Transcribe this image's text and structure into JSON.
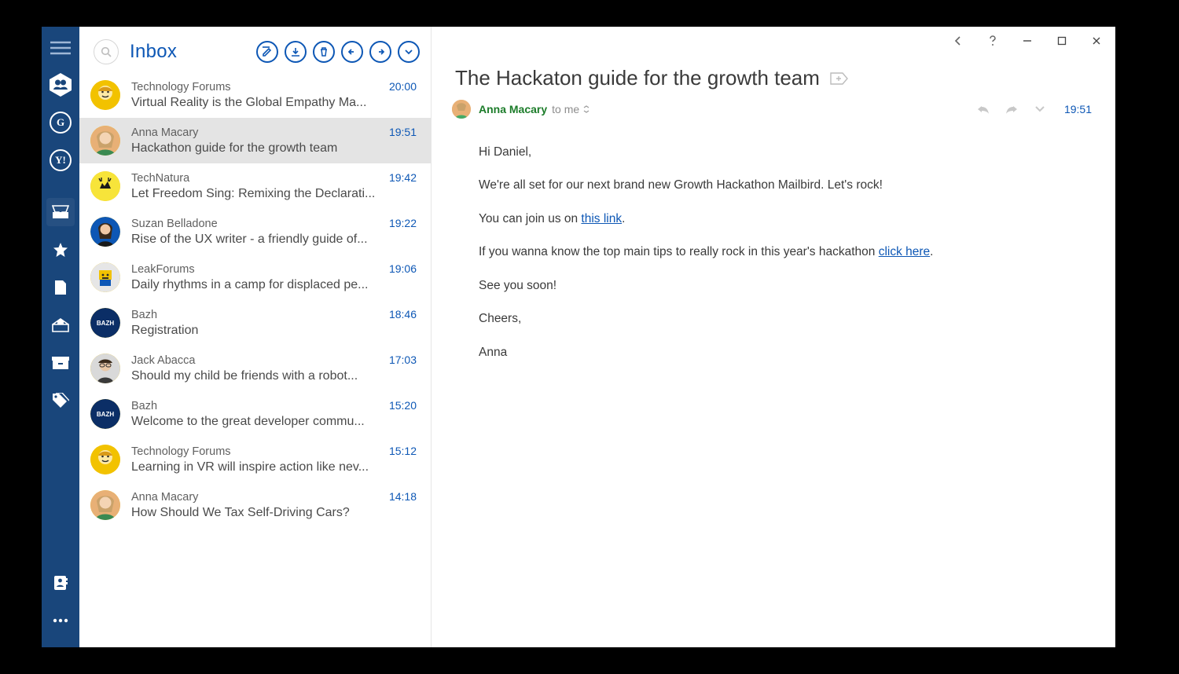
{
  "sidebar": {
    "accounts": [
      {
        "kind": "hex",
        "label": "people"
      },
      {
        "kind": "circle",
        "letter": "G"
      },
      {
        "kind": "circle",
        "letter": "Y!"
      }
    ],
    "nav": [
      {
        "name": "inbox",
        "icon": "tray"
      },
      {
        "name": "starred",
        "icon": "star"
      },
      {
        "name": "drafts",
        "icon": "file"
      },
      {
        "name": "sent",
        "icon": "sent"
      },
      {
        "name": "archive",
        "icon": "archive"
      },
      {
        "name": "tags",
        "icon": "tags"
      }
    ]
  },
  "list": {
    "folder_title": "Inbox",
    "toolbar": {
      "compose": "compose",
      "archive": "archive",
      "delete": "delete",
      "reply": "reply",
      "forward": "forward",
      "more": "more"
    },
    "items": [
      {
        "sender": "Technology Forums",
        "subject": "Virtual Reality is the Global Empathy Ma...",
        "time": "20:00",
        "avatar": "tech"
      },
      {
        "sender": "Anna Macary",
        "subject": "Hackathon guide for the growth team",
        "time": "19:51",
        "avatar": "anna",
        "selected": true
      },
      {
        "sender": "TechNatura",
        "subject": "Let Freedom Sing: Remixing the Declarati...",
        "time": "19:42",
        "avatar": "moose"
      },
      {
        "sender": "Suzan Belladone",
        "subject": "Rise of the UX writer - a friendly guide of...",
        "time": "19:22",
        "avatar": "suzan"
      },
      {
        "sender": "LeakForums",
        "subject": "Daily rhythms in a camp for displaced pe...",
        "time": "19:06",
        "avatar": "leak"
      },
      {
        "sender": "Bazh",
        "subject": "Registration",
        "time": "18:46",
        "avatar": "bazh"
      },
      {
        "sender": "Jack Abacca",
        "subject": "Should my child be friends with a robot...",
        "time": "17:03",
        "avatar": "jack"
      },
      {
        "sender": "Bazh",
        "subject": "Welcome to the great developer commu...",
        "time": "15:20",
        "avatar": "bazh"
      },
      {
        "sender": "Technology Forums",
        "subject": "Learning in VR will inspire action like nev...",
        "time": "15:12",
        "avatar": "tech"
      },
      {
        "sender": "Anna Macary",
        "subject": "How Should We Tax Self-Driving Cars?",
        "time": "14:18",
        "avatar": "anna"
      }
    ]
  },
  "content": {
    "subject": "The Hackaton guide for the growth team",
    "from": "Anna Macary",
    "to_label": "to me",
    "time": "19:51",
    "body": {
      "greeting": "Hi Daniel,",
      "p1": "We're all set for our next brand new Growth Hackathon Mailbird. Let's rock!",
      "p2a": "You can join us on ",
      "p2_link": "this link",
      "p2b": ".",
      "p3a": "If you wanna know the top main tips to really rock in this year's hackathon ",
      "p3_link": "click here",
      "p3b": ".",
      "p4": "See you soon!",
      "p5": "Cheers,",
      "p6": "Anna"
    }
  }
}
